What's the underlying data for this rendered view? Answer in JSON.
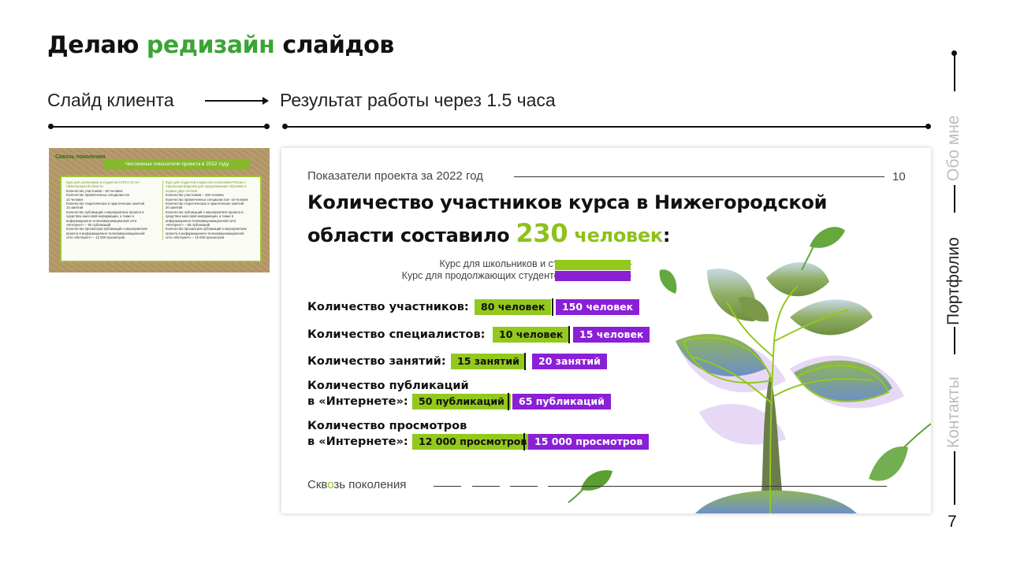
{
  "header": {
    "title_prefix": "Делаю",
    "title_accent": "редизайн",
    "title_suffix": "слайдов",
    "client_label": "Слайд клиента",
    "result_label": "Результат работы через 1.5 часа"
  },
  "client_slide": {
    "logo": "Сквозь поколения",
    "banner": "Численные показатели проекта в 2022 году",
    "col1_heading": "Курс для школьников и студентов СПО в 14 лет Нижегородской области",
    "col1_lines": [
      "Количество участников – 80 человек",
      "Количество привлеченных специалистов",
      "10 человек",
      "Количество теоретических и практических занятий",
      "15 занятий",
      "Количество публикаций о мероприятиях проекта в",
      "средствах массовой информации, а также в",
      "информационно-телекоммуникационной сети",
      "«Интернет» – 50 публикаций",
      "Количество просмотров публикаций о мероприятиях",
      "проекта в информационно-телекоммуникационной",
      "сети «Интернет» – 12 000 просмотров"
    ],
    "col2_heading": "Курс для студентов и взрослого населения России с отдельным модулем для продолжающих обучение и первых двух потоков",
    "col2_lines": [
      "Количество участников – 150 человек",
      "Количество привлеченных специалистов– 15 человек",
      "Количество теоретических и практических занятий",
      "20 занятий",
      "Количество публикаций о мероприятиях проекта в",
      "средствах массовой информации, а также в",
      "информационно-телекоммуникационной сети",
      "«Интернет» – 65 публикаций",
      "Количество просмотров публикаций о мероприятиях",
      "проекта в информационно-телекоммуникационной",
      "сети «Интернет» – 15 000 просмотров"
    ]
  },
  "result_slide": {
    "kicker": "Показатели проекта за 2022 год",
    "slide_number": "10",
    "headline_line1": "Количество участников курса в Нижегородской",
    "headline_line2_prefix": "области составило",
    "headline_value": "230",
    "headline_unit": "человек",
    "headline_colon": ":",
    "legend": [
      {
        "label": "Курс для школьников и студентов СПО —",
        "color": "#93c81d"
      },
      {
        "label": "Курс для продолжающих студентов и взрослых —",
        "color": "#8a1fd6"
      }
    ],
    "metrics": [
      {
        "label": "Количество участников:",
        "green": "80 человек",
        "purple": "150 человек"
      },
      {
        "label": "Количество специалистов:",
        "green": "10 человек",
        "purple": "15 человек"
      },
      {
        "label": "Количество занятий:",
        "green": "15 занятий",
        "purple": "20 занятий"
      },
      {
        "label_line1": "Количество публикаций",
        "label_line2": "в «Интернете»:",
        "green": "50 публикаций",
        "purple": "65 публикаций"
      },
      {
        "label_line1": "Количество просмотров",
        "label_line2": "в «Интернете»:",
        "green": "12 000 просмотров",
        "purple": "15 000 просмотров"
      }
    ],
    "footer_a": "Скв",
    "footer_o": "о",
    "footer_b": "зь поколения"
  },
  "side_nav": {
    "about": "Обо мне",
    "portfolio": "Портфолио",
    "contacts": "Контакты"
  },
  "page_number": "7",
  "colors": {
    "accent_green": "#3aa534",
    "lime": "#93c81d",
    "purple": "#8a1fd6"
  }
}
